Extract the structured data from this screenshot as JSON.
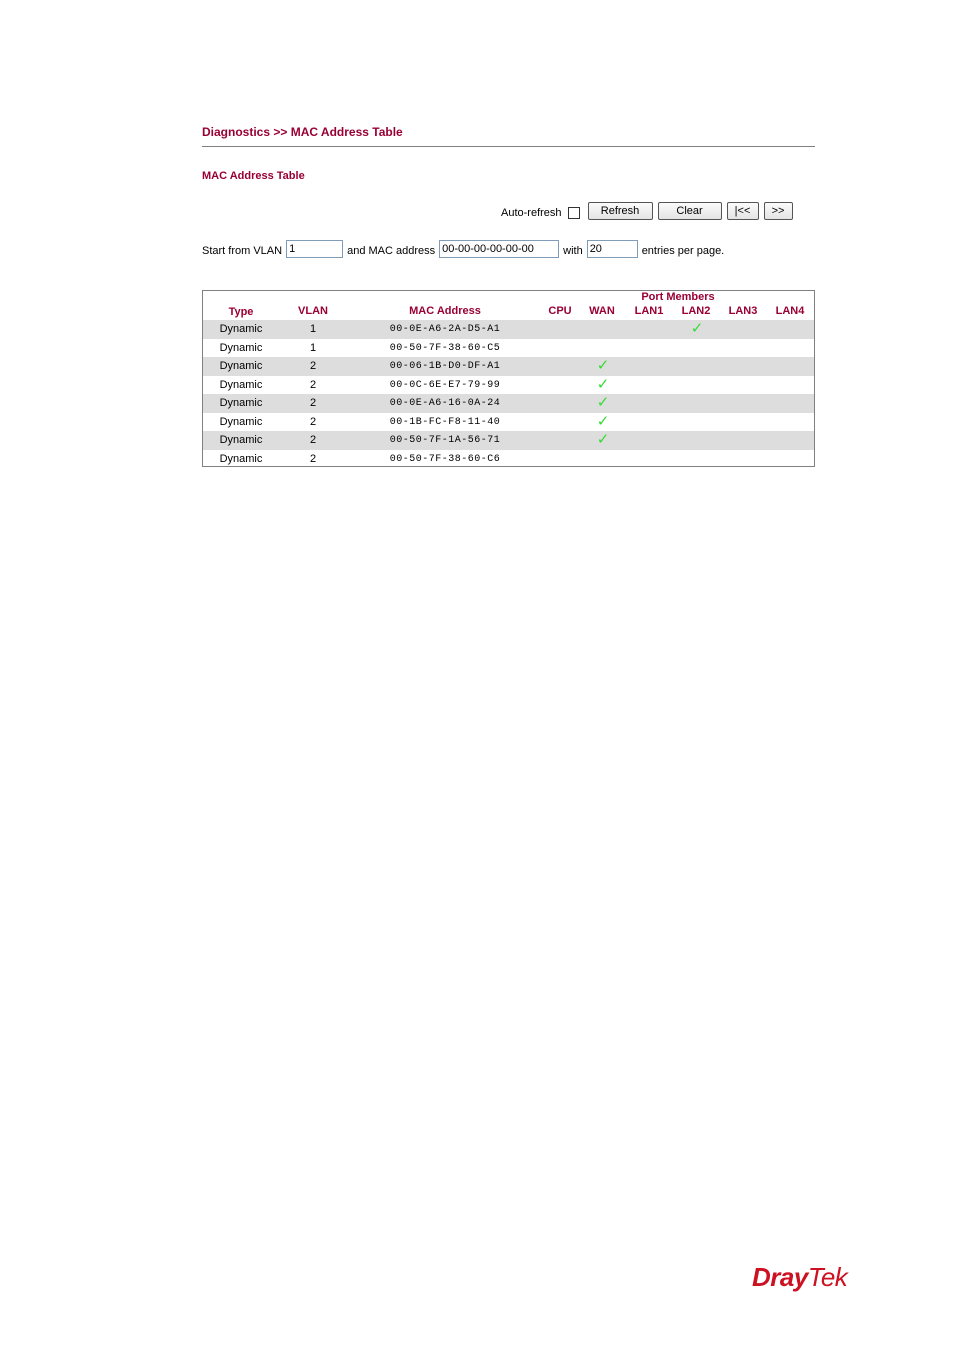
{
  "header": {
    "breadcrumb": "Diagnostics >> MAC Address Table",
    "section_title": "MAC Address Table"
  },
  "toolbar": {
    "auto_refresh_label": "Auto-refresh",
    "auto_refresh_checked": false,
    "refresh_label": "Refresh",
    "clear_label": "Clear",
    "first_label": "|<<",
    "next_label": ">>"
  },
  "filter": {
    "start_vlan_label": "Start from VLAN",
    "start_vlan_value": "1",
    "mac_label": "and MAC address",
    "mac_value": "00-00-00-00-00-00",
    "with_label": "with",
    "entries_value": "20",
    "entries_suffix": "entries per page."
  },
  "table": {
    "group_header": "Port Members",
    "columns": [
      "Type",
      "VLAN",
      "MAC Address",
      "CPU",
      "WAN",
      "LAN1",
      "LAN2",
      "LAN3",
      "LAN4"
    ],
    "check_icon": "checkmark-icon",
    "accent_color": "#990033",
    "check_color": "#33dd33",
    "rows": [
      {
        "type": "Dynamic",
        "vlan": "1",
        "mac": "00-0E-A6-2A-D5-A1",
        "ports": {
          "CPU": false,
          "WAN": false,
          "LAN1": false,
          "LAN2": true,
          "LAN3": false,
          "LAN4": false
        }
      },
      {
        "type": "Dynamic",
        "vlan": "1",
        "mac": "00-50-7F-38-60-C5",
        "ports": {
          "CPU": false,
          "WAN": false,
          "LAN1": false,
          "LAN2": false,
          "LAN3": false,
          "LAN4": false
        }
      },
      {
        "type": "Dynamic",
        "vlan": "2",
        "mac": "00-06-1B-D0-DF-A1",
        "ports": {
          "CPU": false,
          "WAN": true,
          "LAN1": false,
          "LAN2": false,
          "LAN3": false,
          "LAN4": false
        }
      },
      {
        "type": "Dynamic",
        "vlan": "2",
        "mac": "00-0C-6E-E7-79-99",
        "ports": {
          "CPU": false,
          "WAN": true,
          "LAN1": false,
          "LAN2": false,
          "LAN3": false,
          "LAN4": false
        }
      },
      {
        "type": "Dynamic",
        "vlan": "2",
        "mac": "00-0E-A6-16-0A-24",
        "ports": {
          "CPU": false,
          "WAN": true,
          "LAN1": false,
          "LAN2": false,
          "LAN3": false,
          "LAN4": false
        }
      },
      {
        "type": "Dynamic",
        "vlan": "2",
        "mac": "00-1B-FC-F8-11-40",
        "ports": {
          "CPU": false,
          "WAN": true,
          "LAN1": false,
          "LAN2": false,
          "LAN3": false,
          "LAN4": false
        }
      },
      {
        "type": "Dynamic",
        "vlan": "2",
        "mac": "00-50-7F-1A-56-71",
        "ports": {
          "CPU": false,
          "WAN": true,
          "LAN1": false,
          "LAN2": false,
          "LAN3": false,
          "LAN4": false
        }
      },
      {
        "type": "Dynamic",
        "vlan": "2",
        "mac": "00-50-7F-38-60-C6",
        "ports": {
          "CPU": false,
          "WAN": false,
          "LAN1": false,
          "LAN2": false,
          "LAN3": false,
          "LAN4": false
        }
      }
    ]
  },
  "footer": {
    "logo_part1": "Dray",
    "logo_part2": "Tek"
  }
}
